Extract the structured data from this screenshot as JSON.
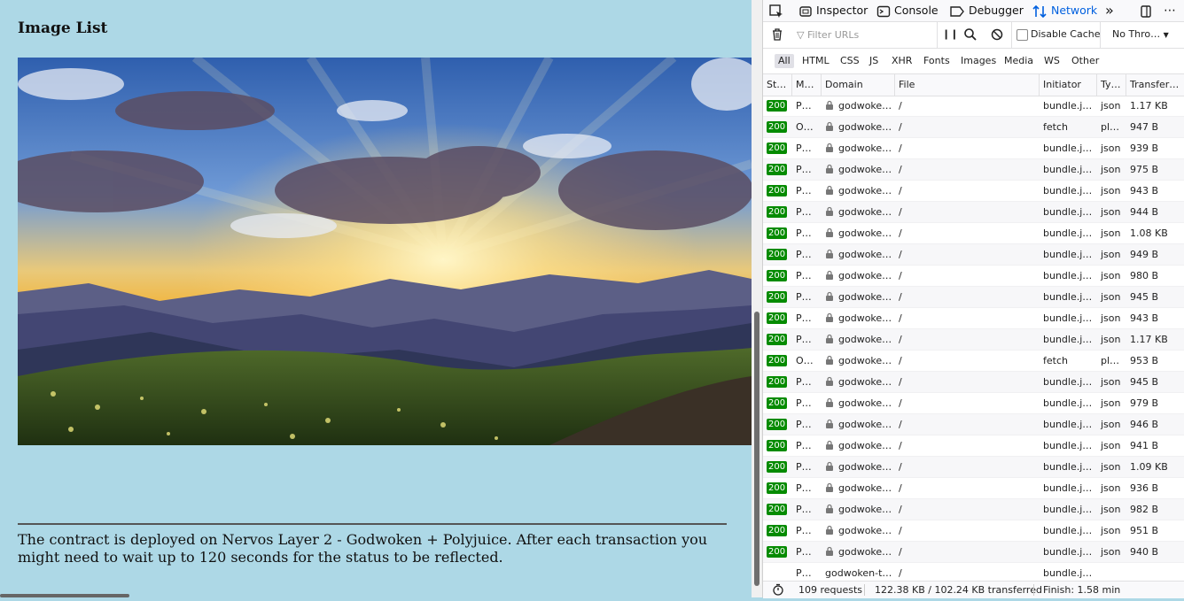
{
  "page": {
    "title": "Image List",
    "notice": "The contract is deployed on Nervos Layer 2 - Godwoken + Polyjuice. After each transaction you might need to wait up to 120 seconds for the status to be reflected."
  },
  "devtools": {
    "tabs": [
      {
        "label": "Inspector",
        "icon": "inspector-icon"
      },
      {
        "label": "Console",
        "icon": "console-icon"
      },
      {
        "label": "Debugger",
        "icon": "debugger-icon"
      },
      {
        "label": "Network",
        "icon": "network-arrows-icon",
        "active": true
      }
    ],
    "toolbar": {
      "filter_placeholder": "Filter URLs",
      "disable_cache": "Disable Cache",
      "throttling": "No Thro…"
    },
    "filters": [
      "All",
      "HTML",
      "CSS",
      "JS",
      "XHR",
      "Fonts",
      "Images",
      "Media",
      "WS",
      "Other"
    ],
    "columns": [
      "St…",
      "M…",
      "Domain",
      "File",
      "Initiator",
      "Ty…",
      "Transfer…"
    ],
    "rows": [
      {
        "status": "200",
        "method": "P…",
        "domain": "godwoke…",
        "file": "/",
        "initiator": "bundle.j…",
        "type": "json",
        "transferred": "1.17 KB"
      },
      {
        "status": "200",
        "method": "O…",
        "domain": "godwoke…",
        "file": "/",
        "initiator": "fetch",
        "type": "pl…",
        "transferred": "947 B"
      },
      {
        "status": "200",
        "method": "P…",
        "domain": "godwoke…",
        "file": "/",
        "initiator": "bundle.j…",
        "type": "json",
        "transferred": "939 B"
      },
      {
        "status": "200",
        "method": "P…",
        "domain": "godwoke…",
        "file": "/",
        "initiator": "bundle.j…",
        "type": "json",
        "transferred": "975 B"
      },
      {
        "status": "200",
        "method": "P…",
        "domain": "godwoke…",
        "file": "/",
        "initiator": "bundle.j…",
        "type": "json",
        "transferred": "943 B"
      },
      {
        "status": "200",
        "method": "P…",
        "domain": "godwoke…",
        "file": "/",
        "initiator": "bundle.j…",
        "type": "json",
        "transferred": "944 B"
      },
      {
        "status": "200",
        "method": "P…",
        "domain": "godwoke…",
        "file": "/",
        "initiator": "bundle.j…",
        "type": "json",
        "transferred": "1.08 KB"
      },
      {
        "status": "200",
        "method": "P…",
        "domain": "godwoke…",
        "file": "/",
        "initiator": "bundle.j…",
        "type": "json",
        "transferred": "949 B"
      },
      {
        "status": "200",
        "method": "P…",
        "domain": "godwoke…",
        "file": "/",
        "initiator": "bundle.j…",
        "type": "json",
        "transferred": "980 B"
      },
      {
        "status": "200",
        "method": "P…",
        "domain": "godwoke…",
        "file": "/",
        "initiator": "bundle.j…",
        "type": "json",
        "transferred": "945 B"
      },
      {
        "status": "200",
        "method": "P…",
        "domain": "godwoke…",
        "file": "/",
        "initiator": "bundle.j…",
        "type": "json",
        "transferred": "943 B"
      },
      {
        "status": "200",
        "method": "P…",
        "domain": "godwoke…",
        "file": "/",
        "initiator": "bundle.j…",
        "type": "json",
        "transferred": "1.17 KB"
      },
      {
        "status": "200",
        "method": "O…",
        "domain": "godwoke…",
        "file": "/",
        "initiator": "fetch",
        "type": "pl…",
        "transferred": "953 B"
      },
      {
        "status": "200",
        "method": "P…",
        "domain": "godwoke…",
        "file": "/",
        "initiator": "bundle.j…",
        "type": "json",
        "transferred": "945 B"
      },
      {
        "status": "200",
        "method": "P…",
        "domain": "godwoke…",
        "file": "/",
        "initiator": "bundle.j…",
        "type": "json",
        "transferred": "979 B"
      },
      {
        "status": "200",
        "method": "P…",
        "domain": "godwoke…",
        "file": "/",
        "initiator": "bundle.j…",
        "type": "json",
        "transferred": "946 B"
      },
      {
        "status": "200",
        "method": "P…",
        "domain": "godwoke…",
        "file": "/",
        "initiator": "bundle.j…",
        "type": "json",
        "transferred": "941 B"
      },
      {
        "status": "200",
        "method": "P…",
        "domain": "godwoke…",
        "file": "/",
        "initiator": "bundle.j…",
        "type": "json",
        "transferred": "1.09 KB"
      },
      {
        "status": "200",
        "method": "P…",
        "domain": "godwoke…",
        "file": "/",
        "initiator": "bundle.j…",
        "type": "json",
        "transferred": "936 B"
      },
      {
        "status": "200",
        "method": "P…",
        "domain": "godwoke…",
        "file": "/",
        "initiator": "bundle.j…",
        "type": "json",
        "transferred": "982 B"
      },
      {
        "status": "200",
        "method": "P…",
        "domain": "godwoke…",
        "file": "/",
        "initiator": "bundle.j…",
        "type": "json",
        "transferred": "951 B"
      },
      {
        "status": "200",
        "method": "P…",
        "domain": "godwoke…",
        "file": "/",
        "initiator": "bundle.j…",
        "type": "json",
        "transferred": "940 B"
      },
      {
        "status": "",
        "method": "P…",
        "domain": "godwoken-t…",
        "file": "/",
        "initiator": "bundle.j…",
        "type": "",
        "transferred": ""
      }
    ],
    "footer": {
      "requests": "109 requests",
      "size": "122.38 KB / 102.24 KB transferred",
      "finish": "Finish: 1.58 min"
    },
    "colors": {
      "accent": "#0060df",
      "status_ok": "#058b00"
    }
  }
}
